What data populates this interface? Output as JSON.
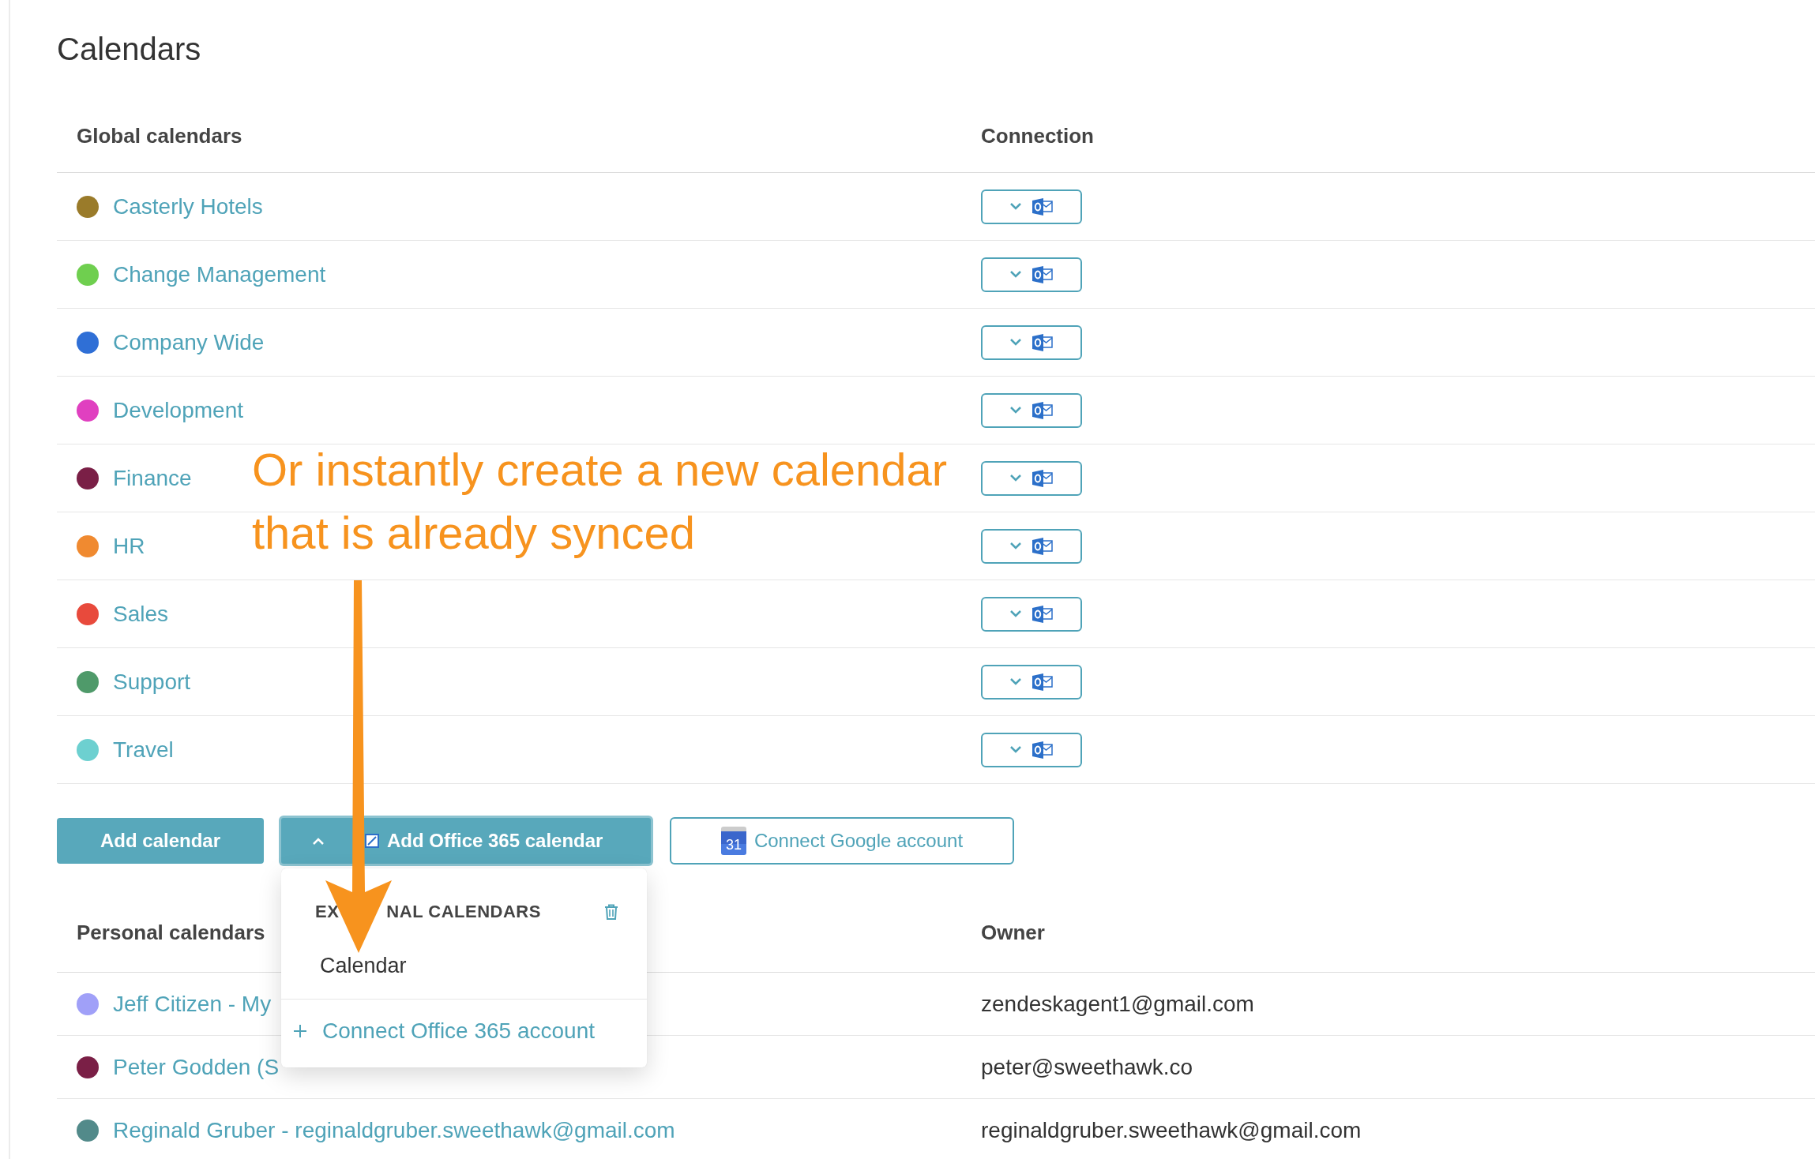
{
  "page": {
    "title": "Calendars"
  },
  "global_calendars": {
    "columns": [
      "Global calendars",
      "Connection"
    ],
    "rows": [
      {
        "name": "Casterly Hotels",
        "color": "#9a7b2a"
      },
      {
        "name": "Change Management",
        "color": "#6fcf4f"
      },
      {
        "name": "Company Wide",
        "color": "#2f6fd6"
      },
      {
        "name": "Development",
        "color": "#e040c0"
      },
      {
        "name": "Finance",
        "color": "#7a1f46"
      },
      {
        "name": "HR",
        "color": "#f08a30"
      },
      {
        "name": "Sales",
        "color": "#e84a3c"
      },
      {
        "name": "Support",
        "color": "#4f9a6a"
      },
      {
        "name": "Travel",
        "color": "#6dd0d0"
      }
    ]
  },
  "actions": [
    {
      "kind": "primary",
      "label": "Add calendar"
    },
    {
      "kind": "dropdown",
      "label": "Add Office 365 calendar",
      "expanded": true
    },
    {
      "kind": "google",
      "label": "Connect Google account",
      "icon_label": "31"
    }
  ],
  "dropdown": {
    "heading_parts": [
      "EX",
      "NAL CALENDARS"
    ],
    "items": [
      "Calendar"
    ],
    "footer": "Connect Office 365 account"
  },
  "personal_calendars": {
    "columns": [
      "Personal calendars",
      "Owner"
    ],
    "rows": [
      {
        "name": "Jeff Citizen - My",
        "color": "#a0a0f8",
        "owner": "zendeskagent1@gmail.com"
      },
      {
        "name": "Peter Godden (S",
        "color": "#7a1f46",
        "owner": "peter@sweethawk.co"
      },
      {
        "name": "Reginald Gruber - reginaldgruber.sweethawk@gmail.com",
        "color": "#528a8a",
        "owner": "reginaldgruber.sweethawk@gmail.com"
      }
    ]
  },
  "annotation": {
    "lines": [
      "Or instantly create a new calendar",
      "that is already synced"
    ]
  }
}
